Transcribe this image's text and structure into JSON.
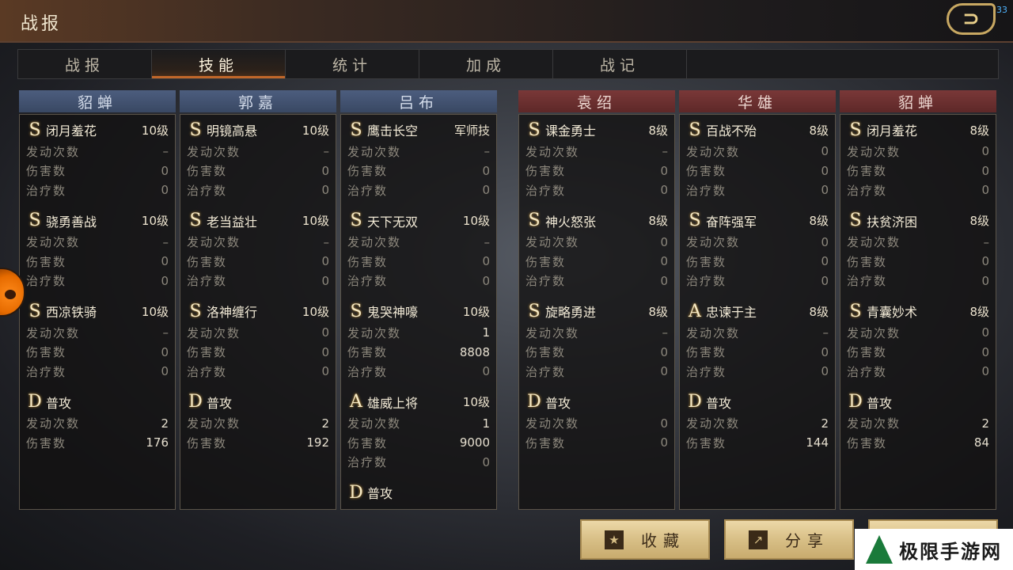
{
  "title": "战报",
  "fps": "33",
  "tabs": [
    "战报",
    "技能",
    "统计",
    "加成",
    "战记"
  ],
  "active_tab": "技能",
  "labels": {
    "trigger": "发动次数",
    "damage": "伤害数",
    "heal": "治疗数"
  },
  "columns": [
    {
      "side": "blue",
      "name": "貂蝉",
      "skills": [
        {
          "grade": "S",
          "name": "闭月羞花",
          "level": "10级",
          "trigger": "–",
          "damage": "0",
          "heal": "0"
        },
        {
          "grade": "S",
          "name": "骁勇善战",
          "level": "10级",
          "trigger": "–",
          "damage": "0",
          "heal": "0"
        },
        {
          "grade": "S",
          "name": "西凉铁骑",
          "level": "10级",
          "trigger": "–",
          "damage": "0",
          "heal": "0"
        },
        {
          "grade": "D",
          "name": "普攻",
          "level": "",
          "trigger": "2",
          "damage": "176"
        }
      ]
    },
    {
      "side": "blue",
      "name": "郭嘉",
      "skills": [
        {
          "grade": "S",
          "name": "明镜高悬",
          "level": "10级",
          "trigger": "–",
          "damage": "0",
          "heal": "0"
        },
        {
          "grade": "S",
          "name": "老当益壮",
          "level": "10级",
          "trigger": "–",
          "damage": "0",
          "heal": "0"
        },
        {
          "grade": "S",
          "name": "洛神缠行",
          "level": "10级",
          "trigger": "0",
          "damage": "0",
          "heal": "0"
        },
        {
          "grade": "D",
          "name": "普攻",
          "level": "",
          "trigger": "2",
          "damage": "192"
        }
      ]
    },
    {
      "side": "blue",
      "name": "吕布",
      "skills": [
        {
          "grade": "S",
          "name": "鹰击长空",
          "level": "军师技",
          "trigger": "–",
          "damage": "0",
          "heal": "0"
        },
        {
          "grade": "S",
          "name": "天下无双",
          "level": "10级",
          "trigger": "–",
          "damage": "0",
          "heal": "0"
        },
        {
          "grade": "S",
          "name": "鬼哭神嚎",
          "level": "10级",
          "trigger": "1",
          "damage": "8808",
          "heal": "0"
        },
        {
          "grade": "A",
          "name": "雄威上将",
          "level": "10级",
          "trigger": "1",
          "damage": "9000",
          "heal": "0"
        },
        {
          "grade": "D",
          "name": "普攻",
          "level": ""
        }
      ]
    },
    {
      "side": "red",
      "name": "袁绍",
      "skills": [
        {
          "grade": "S",
          "name": "课金勇士",
          "level": "8级",
          "trigger": "–",
          "damage": "0",
          "heal": "0"
        },
        {
          "grade": "S",
          "name": "神火怒张",
          "level": "8级",
          "trigger": "0",
          "damage": "0",
          "heal": "0"
        },
        {
          "grade": "S",
          "name": "旋略勇进",
          "level": "8级",
          "trigger": "–",
          "damage": "0",
          "heal": "0"
        },
        {
          "grade": "D",
          "name": "普攻",
          "level": "",
          "trigger": "0",
          "damage": "0"
        }
      ]
    },
    {
      "side": "red",
      "name": "华雄",
      "skills": [
        {
          "grade": "S",
          "name": "百战不殆",
          "level": "8级",
          "trigger": "0",
          "damage": "0",
          "heal": "0"
        },
        {
          "grade": "S",
          "name": "奋阵强军",
          "level": "8级",
          "trigger": "0",
          "damage": "0",
          "heal": "0"
        },
        {
          "grade": "A",
          "name": "忠谏于主",
          "level": "8级",
          "trigger": "–",
          "damage": "0",
          "heal": "0"
        },
        {
          "grade": "D",
          "name": "普攻",
          "level": "",
          "trigger": "2",
          "damage": "144"
        }
      ]
    },
    {
      "side": "red",
      "name": "貂蝉",
      "skills": [
        {
          "grade": "S",
          "name": "闭月羞花",
          "level": "8级",
          "trigger": "0",
          "damage": "0",
          "heal": "0"
        },
        {
          "grade": "S",
          "name": "扶贫济困",
          "level": "8级",
          "trigger": "–",
          "damage": "0",
          "heal": "0"
        },
        {
          "grade": "S",
          "name": "青囊妙术",
          "level": "8级",
          "trigger": "0",
          "damage": "0",
          "heal": "0"
        },
        {
          "grade": "D",
          "name": "普攻",
          "level": "",
          "trigger": "2",
          "damage": "84"
        }
      ]
    }
  ],
  "buttons": {
    "favorite": "收藏",
    "share": "分享"
  },
  "watermark": "极限手游网"
}
